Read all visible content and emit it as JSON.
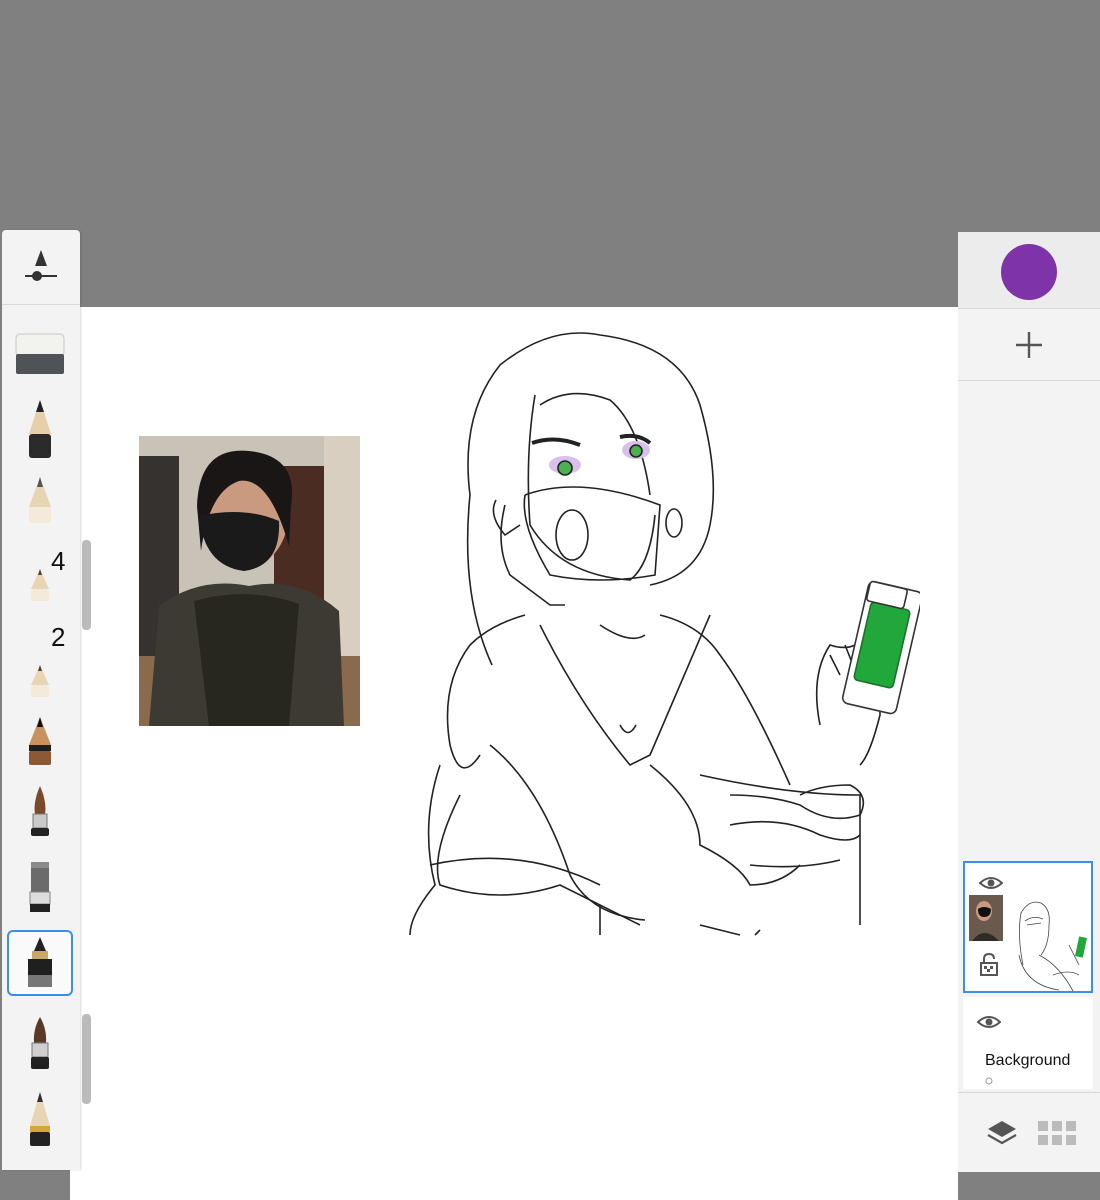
{
  "toolbar": {
    "tools": [
      {
        "name": "eraser"
      },
      {
        "name": "pencil-dark"
      },
      {
        "name": "pencil-light"
      },
      {
        "name": "pencil-light-small",
        "size_label": "4"
      },
      {
        "name": "pencil-light-smaller",
        "size_label": "2"
      },
      {
        "name": "pencil-wood"
      },
      {
        "name": "paintbrush"
      },
      {
        "name": "flat-brush"
      },
      {
        "name": "fountain-pen",
        "selected": true
      },
      {
        "name": "brush-pen"
      },
      {
        "name": "pencil-striped"
      }
    ]
  },
  "color": {
    "current": "#7e34a8"
  },
  "layers": {
    "background_label": "Background"
  },
  "icons": {
    "brush-settings": "brush-settings-icon",
    "add": "plus-icon",
    "visibility": "eye-icon",
    "lock": "lock-icon",
    "layers": "layers-icon",
    "grid": "grid-icon"
  }
}
